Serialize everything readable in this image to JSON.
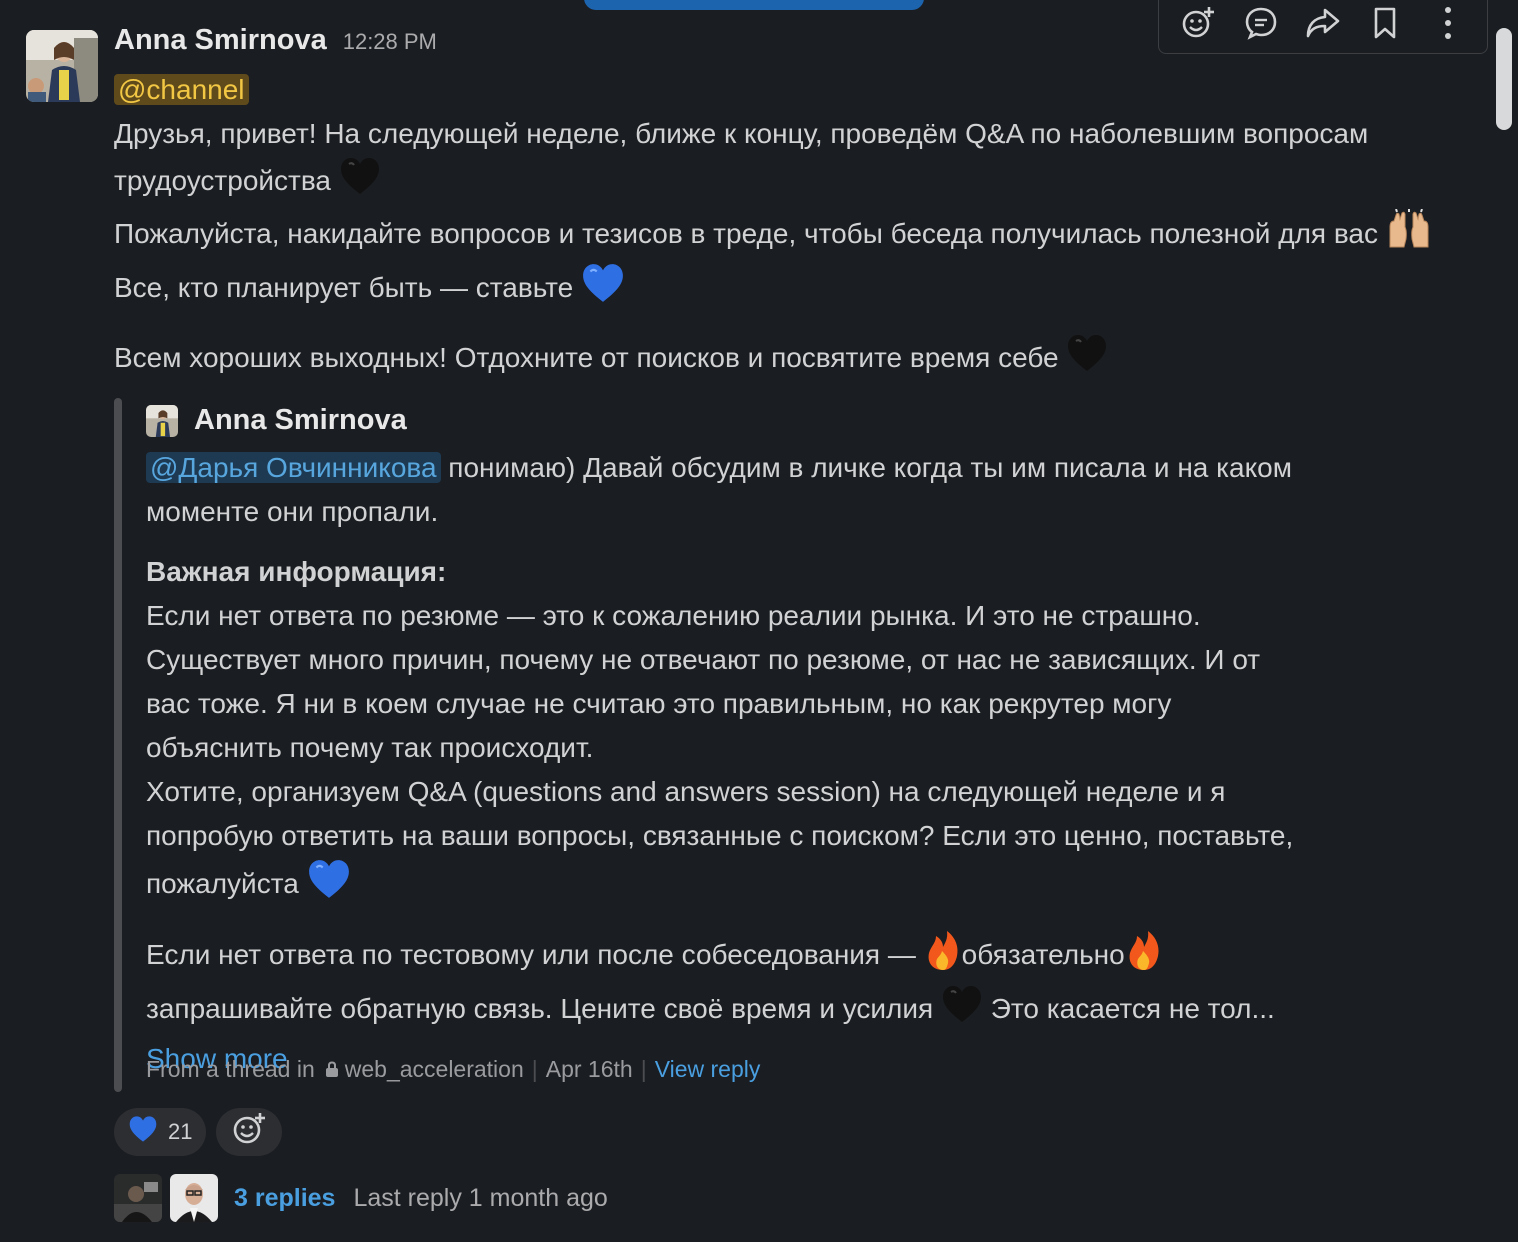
{
  "message": {
    "author": "Anna Smirnova",
    "timestamp": "12:28 PM",
    "channel_mention": "@channel",
    "line1": "Друзья, привет! На следующей неделе, ближе к концу, проведём Q&A по наболевшим вопросам трудоустройства",
    "line2": "Пожалуйста, накидайте вопросов и тезисов в треде, чтобы беседа получилась полезной для вас",
    "line3": "Все, кто планирует быть — ставьте",
    "line4": "Всем хороших выходных! Отдохните от поисков и посвятите время себе"
  },
  "quote": {
    "author": "Anna Smirnova",
    "user_mention": "@Дарья Овчинникова",
    "intro": " понимаю) Давай обсудим в личке когда ты им писала и на каком моменте они пропали.",
    "heading": "Важная информация:",
    "para1": "Если нет ответа по резюме — это к сожалению реалии рынка. И это не страшно. Существует много причин, почему не отвечают по резюме, от нас не зависящих. И от вас тоже. Я ни в коем случае не считаю это правильным, но как рекрутер могу объяснить почему так происходит.",
    "para2": "Хотите, организуем Q&A (questions and answers session) на следующей неделе и я попробую ответить на ваши вопросы, связанные с поиском? Если это ценно, поставьте, пожалуйста",
    "para3_a": "Если нет ответа по тестовому или после собеседования — ",
    "para3_b": "обязательно",
    "para3_c": " запрашивайте обратную связь. Цените своё время и усилия ",
    "para3_d": " Это касается не тол...",
    "show_more": "Show more",
    "meta_from": "From a thread in",
    "meta_channel": "web_acceleration",
    "meta_date": "Apr 16th",
    "meta_view": "View reply"
  },
  "reactions": [
    {
      "emoji": "blue-heart",
      "count": "21"
    }
  ],
  "thread": {
    "replies": "3 replies",
    "last_reply": "Last reply 1 month ago"
  },
  "toolbar": {
    "actions": [
      "add-reaction",
      "reply-in-thread",
      "share",
      "save",
      "more-actions"
    ]
  },
  "colors": {
    "background": "#1a1d21",
    "text": "#d1d2d3",
    "link": "#4a9fe1",
    "channel_mention_bg": "#5f4a1b",
    "channel_mention_fg": "#f2c744",
    "user_mention_bg": "#1e3a52",
    "user_mention_fg": "#58a6de"
  }
}
